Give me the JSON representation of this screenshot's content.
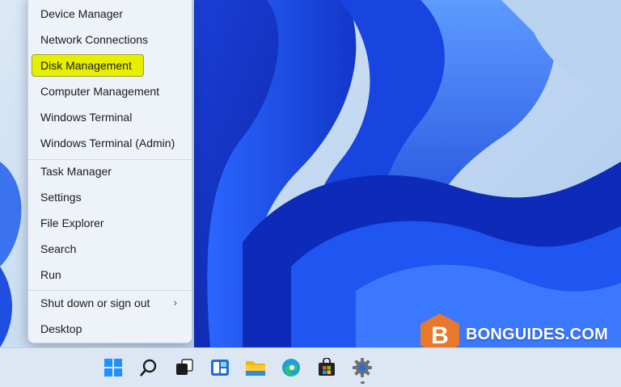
{
  "context_menu": {
    "items": [
      {
        "label": "Device Manager"
      },
      {
        "label": "Network Connections"
      },
      {
        "label": "Disk Management"
      },
      {
        "label": "Computer Management"
      },
      {
        "label": "Windows Terminal"
      },
      {
        "label": "Windows Terminal (Admin)"
      },
      {
        "label": "Task Manager"
      },
      {
        "label": "Settings"
      },
      {
        "label": "File Explorer"
      },
      {
        "label": "Search"
      },
      {
        "label": "Run"
      },
      {
        "label": "Shut down or sign out"
      },
      {
        "label": "Desktop"
      }
    ],
    "highlighted": "Disk Management",
    "highlight_color": "#e6ef00"
  },
  "taskbar": {
    "icons": [
      "start-icon",
      "search-icon",
      "task-view-icon",
      "widgets-icon",
      "file-explorer-icon",
      "edge-icon",
      "store-icon",
      "settings-icon"
    ]
  },
  "watermark": {
    "letter": "B",
    "text": "BONGUIDES.COM",
    "color": "#e8792b"
  }
}
